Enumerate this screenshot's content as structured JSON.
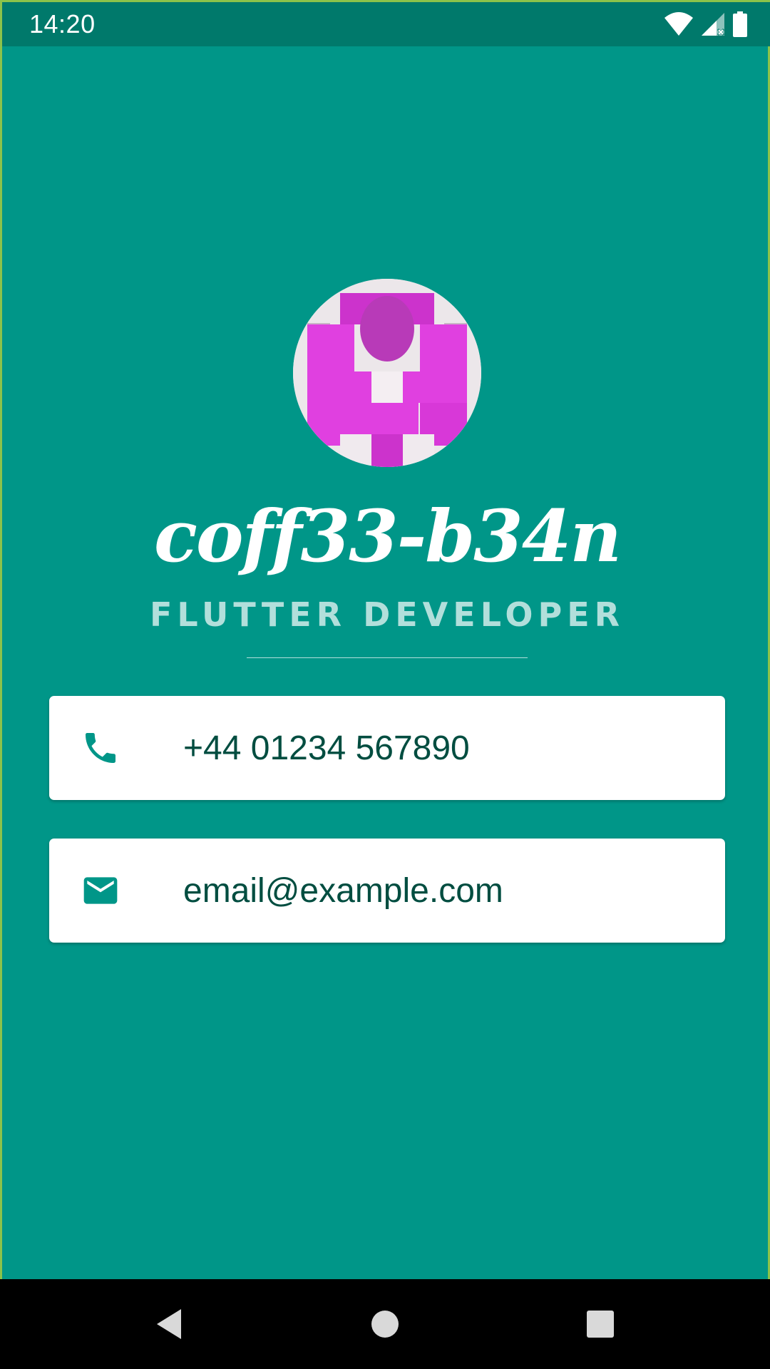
{
  "status_bar": {
    "time": "14:20",
    "icons": [
      "wifi-icon",
      "signal-icon",
      "battery-icon"
    ]
  },
  "profile": {
    "avatar": "avatar-photo",
    "name": "coff33-b34n",
    "title": "FLUTTER DEVELOPER"
  },
  "contacts": {
    "phone": {
      "icon": "phone-icon",
      "value": "+44 01234 567890"
    },
    "email": {
      "icon": "email-icon",
      "value": "email@example.com"
    }
  },
  "nav_bar": {
    "buttons": [
      "back-icon",
      "home-icon",
      "recents-icon"
    ]
  },
  "colors": {
    "background": "#009688",
    "status_bar": "#00796b",
    "card": "#ffffff",
    "card_text": "#004d40",
    "title_text": "#b2dfdb",
    "icon": "#009688"
  }
}
